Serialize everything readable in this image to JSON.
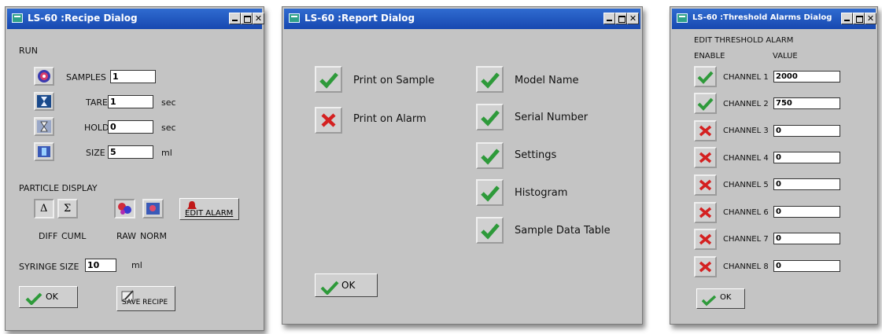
{
  "colors": {
    "window_bg": "#c4c4c4",
    "titlebar": "#1e56c0",
    "check_green": "#2e9a3a",
    "cross_red": "#d42020"
  },
  "recipe": {
    "title": "LS-60 :Recipe Dialog",
    "run_label": "RUN",
    "samples": {
      "label": "SAMPLES",
      "value": "1"
    },
    "tare": {
      "label": "TARE",
      "value": "1",
      "unit": "sec"
    },
    "hold": {
      "label": "HOLD",
      "value": "0",
      "unit": "sec"
    },
    "size": {
      "label": "SIZE",
      "value": "5",
      "unit": "ml"
    },
    "particle_display_label": "PARTICLE DISPLAY",
    "diff_symbol": "Δ",
    "cuml_symbol": "Σ",
    "diff_label": "DIFF",
    "cuml_label": "CUML",
    "raw_label": "RAW",
    "norm_label": "NORM",
    "edit_alarm_label": "EDIT ALARM",
    "syringe": {
      "label": "SYRINGE SIZE",
      "value": "10",
      "unit": "ml"
    },
    "ok_label": "OK",
    "save_recipe_label": "SAVE RECIPE"
  },
  "report": {
    "title": "LS-60 :Report Dialog",
    "print_on_sample": "Print on Sample",
    "print_on_alarm": "Print on Alarm",
    "model_name": "Model Name",
    "serial_number": "Serial Number",
    "settings": "Settings",
    "histogram": "Histogram",
    "sample_data_table": "Sample Data Table",
    "ok_label": "OK"
  },
  "threshold": {
    "title": "LS-60 :Threshold Alarms Dialog",
    "header": "EDIT THRESHOLD ALARM",
    "enable_label": "ENABLE",
    "value_label": "VALUE",
    "channels": [
      {
        "label": "CHANNEL 1",
        "value": "2000",
        "enabled": true
      },
      {
        "label": "CHANNEL 2",
        "value": "750",
        "enabled": true
      },
      {
        "label": "CHANNEL 3",
        "value": "0",
        "enabled": false
      },
      {
        "label": "CHANNEL 4",
        "value": "0",
        "enabled": false
      },
      {
        "label": "CHANNEL 5",
        "value": "0",
        "enabled": false
      },
      {
        "label": "CHANNEL 6",
        "value": "0",
        "enabled": false
      },
      {
        "label": "CHANNEL 7",
        "value": "0",
        "enabled": false
      },
      {
        "label": "CHANNEL 8",
        "value": "0",
        "enabled": false
      }
    ],
    "ok_label": "OK"
  }
}
